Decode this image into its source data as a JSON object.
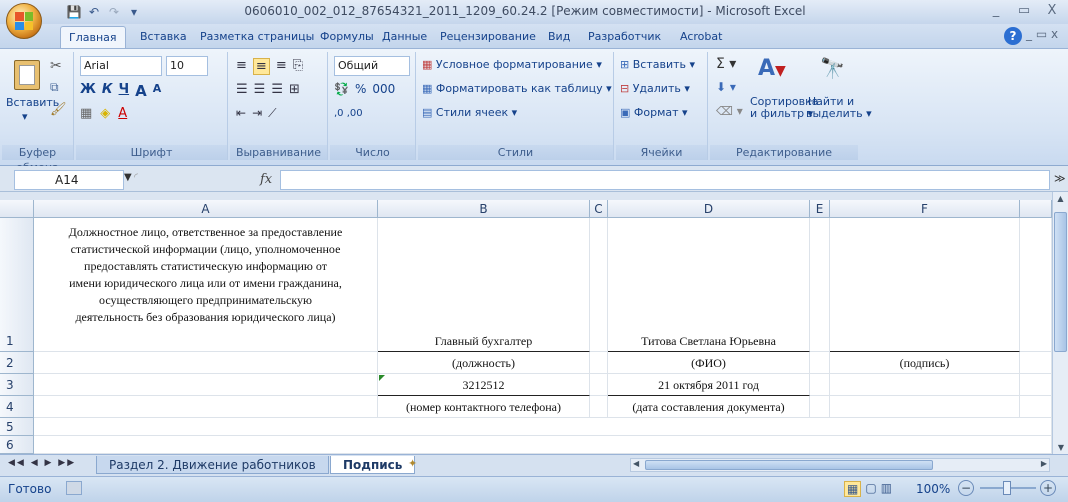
{
  "window": {
    "title": "0606010_002_012_87654321_2011_1209_60.24.2  [Режим совместимости] - Microsoft Excel",
    "minimize": "_",
    "maximize": "▭",
    "close": "X"
  },
  "tabs": [
    "Главная",
    "Вставка",
    "Разметка страницы",
    "Формулы",
    "Данные",
    "Рецензирование",
    "Вид",
    "Разработчик",
    "Acrobat"
  ],
  "ribbon": {
    "clipboard": {
      "paste": "Вставить",
      "label": "Буфер обмена"
    },
    "font": {
      "name": "Arial",
      "size": "10",
      "bold": "Ж",
      "italic": "К",
      "underline": "Ч",
      "grow": "A",
      "shrink": "A",
      "label": "Шрифт"
    },
    "alignment": {
      "label": "Выравнивание"
    },
    "number": {
      "format": "Общий",
      "percent": "%",
      "thousands": "000",
      "inc": ",0 ,00",
      "label": "Число"
    },
    "styles": {
      "conditional": "Условное форматирование",
      "table": "Форматировать как таблицу",
      "cell": "Стили ячеек",
      "label": "Стили"
    },
    "cells": {
      "insert": "Вставить",
      "delete": "Удалить",
      "format": "Формат",
      "label": "Ячейки"
    },
    "editing": {
      "sigma": "Σ",
      "sort1": "Сортировка",
      "sort2": "и фильтр",
      "find1": "Найти и",
      "find2": "выделить",
      "label": "Редактирование"
    }
  },
  "namebox": "A14",
  "fx": "fx",
  "columns": [
    "A",
    "B",
    "C",
    "D",
    "E",
    "F"
  ],
  "rows": {
    "r1": {
      "num": "1",
      "a_lines": [
        "Должностное лицо, ответственное за предоставление",
        "статистической информации (лицо, уполномоченное",
        "предоставлять статистическую информацию от",
        "имени юридического лица или от имени гражданина,",
        "осуществляющего предпринимательскую",
        "деятельность без образования юридического лица)"
      ],
      "b": "Главный бухгалтер",
      "d": "Титова Светлана Юрьевна"
    },
    "r2": {
      "num": "2",
      "b": "(должность)",
      "d": "(ФИО)",
      "f": "(подпись)"
    },
    "r3": {
      "num": "3",
      "b": "3212512",
      "d": "21 октября 2011 год"
    },
    "r4": {
      "num": "4",
      "b": "(номер контактного телефона)",
      "d": "(дата составления документа)"
    },
    "r5": {
      "num": "5"
    },
    "r6": {
      "num": "6"
    }
  },
  "sheets": {
    "nav": "◀◀ ◀ ▶ ▶▶",
    "sheet1": "Раздел 2. Движение работников",
    "sheet2": "Подпись"
  },
  "status": {
    "ready": "Готово",
    "zoom": "100%"
  }
}
